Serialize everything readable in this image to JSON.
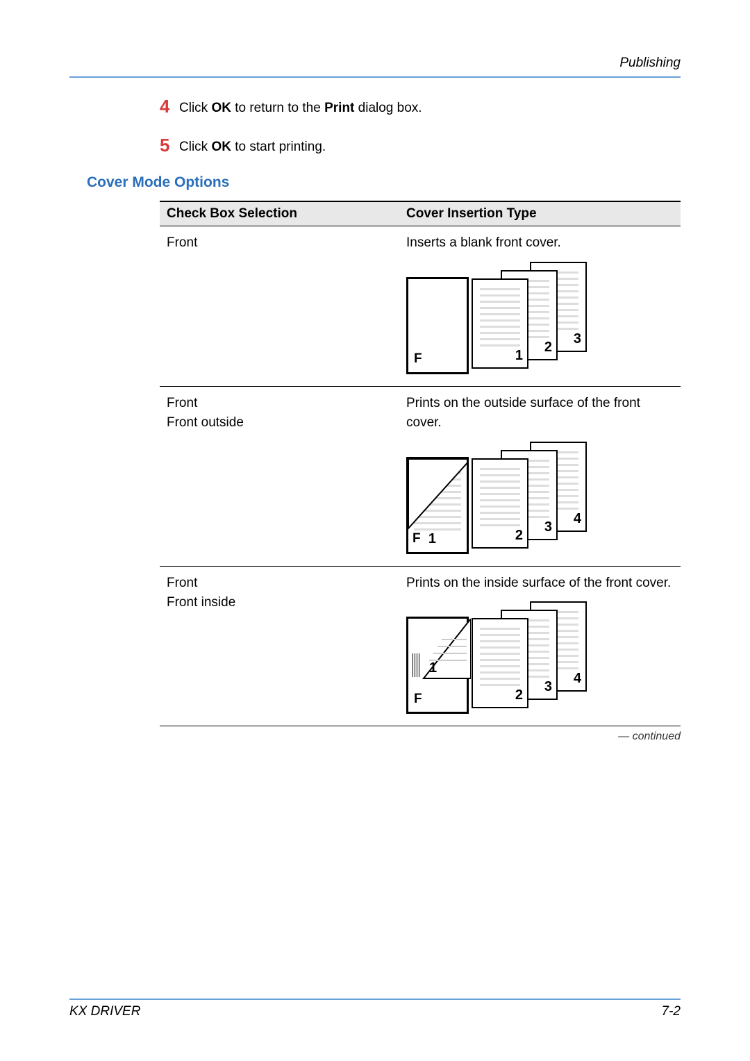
{
  "header": {
    "section": "Publishing"
  },
  "steps": [
    {
      "num": "4",
      "pre": "Click ",
      "b1": "OK",
      "mid": " to return to the ",
      "b2": "Print",
      "post": " dialog box."
    },
    {
      "num": "5",
      "pre": "Click ",
      "b1": "OK",
      "mid": " to start printing.",
      "b2": "",
      "post": ""
    }
  ],
  "section_heading": "Cover Mode Options",
  "table": {
    "headers": [
      "Check Box Selection",
      "Cover Insertion Type"
    ],
    "rows": [
      {
        "selection": [
          "Front"
        ],
        "description": "Inserts a blank front cover.",
        "diagram": "blank"
      },
      {
        "selection": [
          "Front",
          "Front outside"
        ],
        "description": "Prints on the outside surface of the front cover.",
        "diagram": "outside"
      },
      {
        "selection": [
          "Front",
          "Front inside"
        ],
        "description": "Prints on the inside surface of the front cover.",
        "diagram": "inside"
      }
    ]
  },
  "continued": "— continued",
  "footer": {
    "left": "KX DRIVER",
    "right": "7-2"
  }
}
